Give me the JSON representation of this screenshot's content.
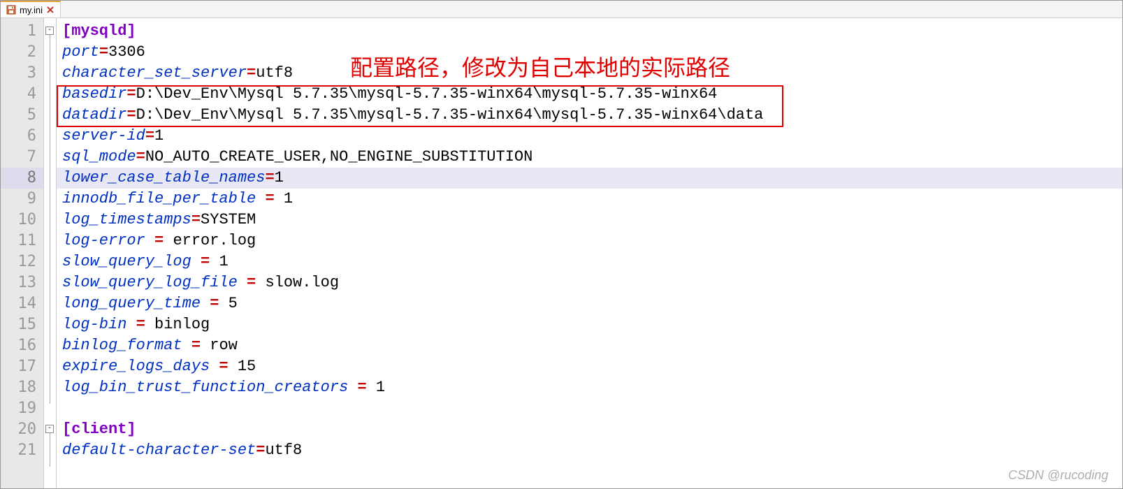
{
  "tab": {
    "filename": "my.ini"
  },
  "fold": {
    "minus": "-"
  },
  "annotation": "配置路径，修改为自己本地的实际路径",
  "watermark": "CSDN @rucoding",
  "lines": [
    {
      "n": "1",
      "type": "section",
      "text": "[mysqld]"
    },
    {
      "n": "2",
      "type": "kv",
      "key": "port",
      "eq": "=",
      "val": "3306"
    },
    {
      "n": "3",
      "type": "kv",
      "key": "character_set_server",
      "eq": "=",
      "val": "utf8"
    },
    {
      "n": "4",
      "type": "kv",
      "key": "basedir",
      "eq": "=",
      "val": "D:\\Dev_Env\\Mysql 5.7.35\\mysql-5.7.35-winx64\\mysql-5.7.35-winx64"
    },
    {
      "n": "5",
      "type": "kv",
      "key": "datadir",
      "eq": "=",
      "val": "D:\\Dev_Env\\Mysql 5.7.35\\mysql-5.7.35-winx64\\mysql-5.7.35-winx64\\data"
    },
    {
      "n": "6",
      "type": "kv",
      "key": "server-id",
      "eq": "=",
      "val": "1"
    },
    {
      "n": "7",
      "type": "kv",
      "key": "sql_mode",
      "eq": "=",
      "val": "NO_AUTO_CREATE_USER,NO_ENGINE_SUBSTITUTION"
    },
    {
      "n": "8",
      "type": "kv",
      "key": "lower_case_table_names",
      "eq": "=",
      "val": "1",
      "active": true
    },
    {
      "n": "9",
      "type": "kv",
      "key": "innodb_file_per_table",
      "eq": " = ",
      "val": "1"
    },
    {
      "n": "10",
      "type": "kv",
      "key": "log_timestamps",
      "eq": "=",
      "val": "SYSTEM"
    },
    {
      "n": "11",
      "type": "kv",
      "key": "log-error",
      "eq": " = ",
      "val": "error.log"
    },
    {
      "n": "12",
      "type": "kv",
      "key": "slow_query_log",
      "eq": " = ",
      "val": "1"
    },
    {
      "n": "13",
      "type": "kv",
      "key": "slow_query_log_file",
      "eq": " = ",
      "val": "slow.log"
    },
    {
      "n": "14",
      "type": "kv",
      "key": "long_query_time",
      "eq": " = ",
      "val": "5"
    },
    {
      "n": "15",
      "type": "kv",
      "key": "log-bin",
      "eq": " = ",
      "val": "binlog"
    },
    {
      "n": "16",
      "type": "kv",
      "key": "binlog_format",
      "eq": " = ",
      "val": "row"
    },
    {
      "n": "17",
      "type": "kv",
      "key": "expire_logs_days",
      "eq": " = ",
      "val": "15"
    },
    {
      "n": "18",
      "type": "kv",
      "key": "log_bin_trust_function_creators",
      "eq": " = ",
      "val": "1"
    },
    {
      "n": "19",
      "type": "blank"
    },
    {
      "n": "20",
      "type": "section",
      "text": "[client]"
    },
    {
      "n": "21",
      "type": "kv",
      "key": "default-character-set",
      "eq": "=",
      "val": "utf8"
    }
  ]
}
